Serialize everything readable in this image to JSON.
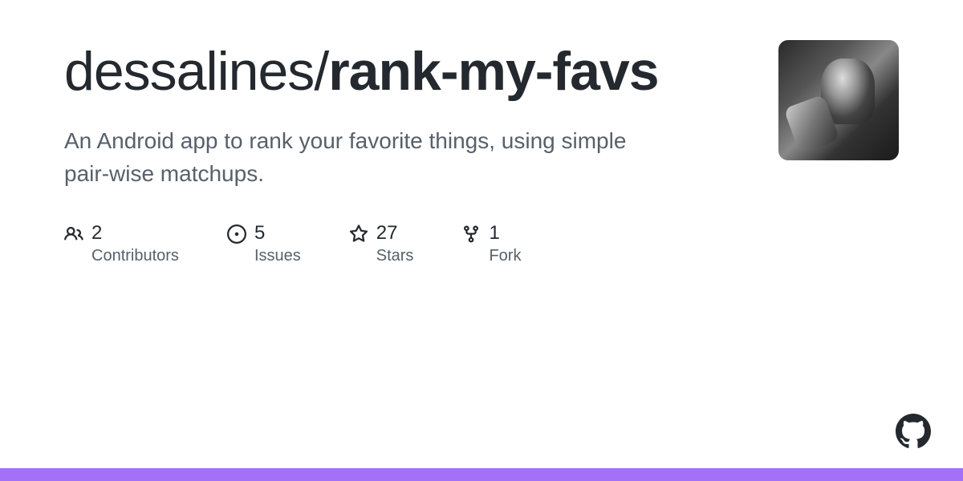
{
  "repo": {
    "owner": "dessalines",
    "name": "rank-my-favs",
    "description": "An Android app to rank your favorite things, using simple pair-wise matchups."
  },
  "stats": {
    "contributors": {
      "count": "2",
      "label": "Contributors"
    },
    "issues": {
      "count": "5",
      "label": "Issues"
    },
    "stars": {
      "count": "27",
      "label": "Stars"
    },
    "forks": {
      "count": "1",
      "label": "Fork"
    }
  }
}
